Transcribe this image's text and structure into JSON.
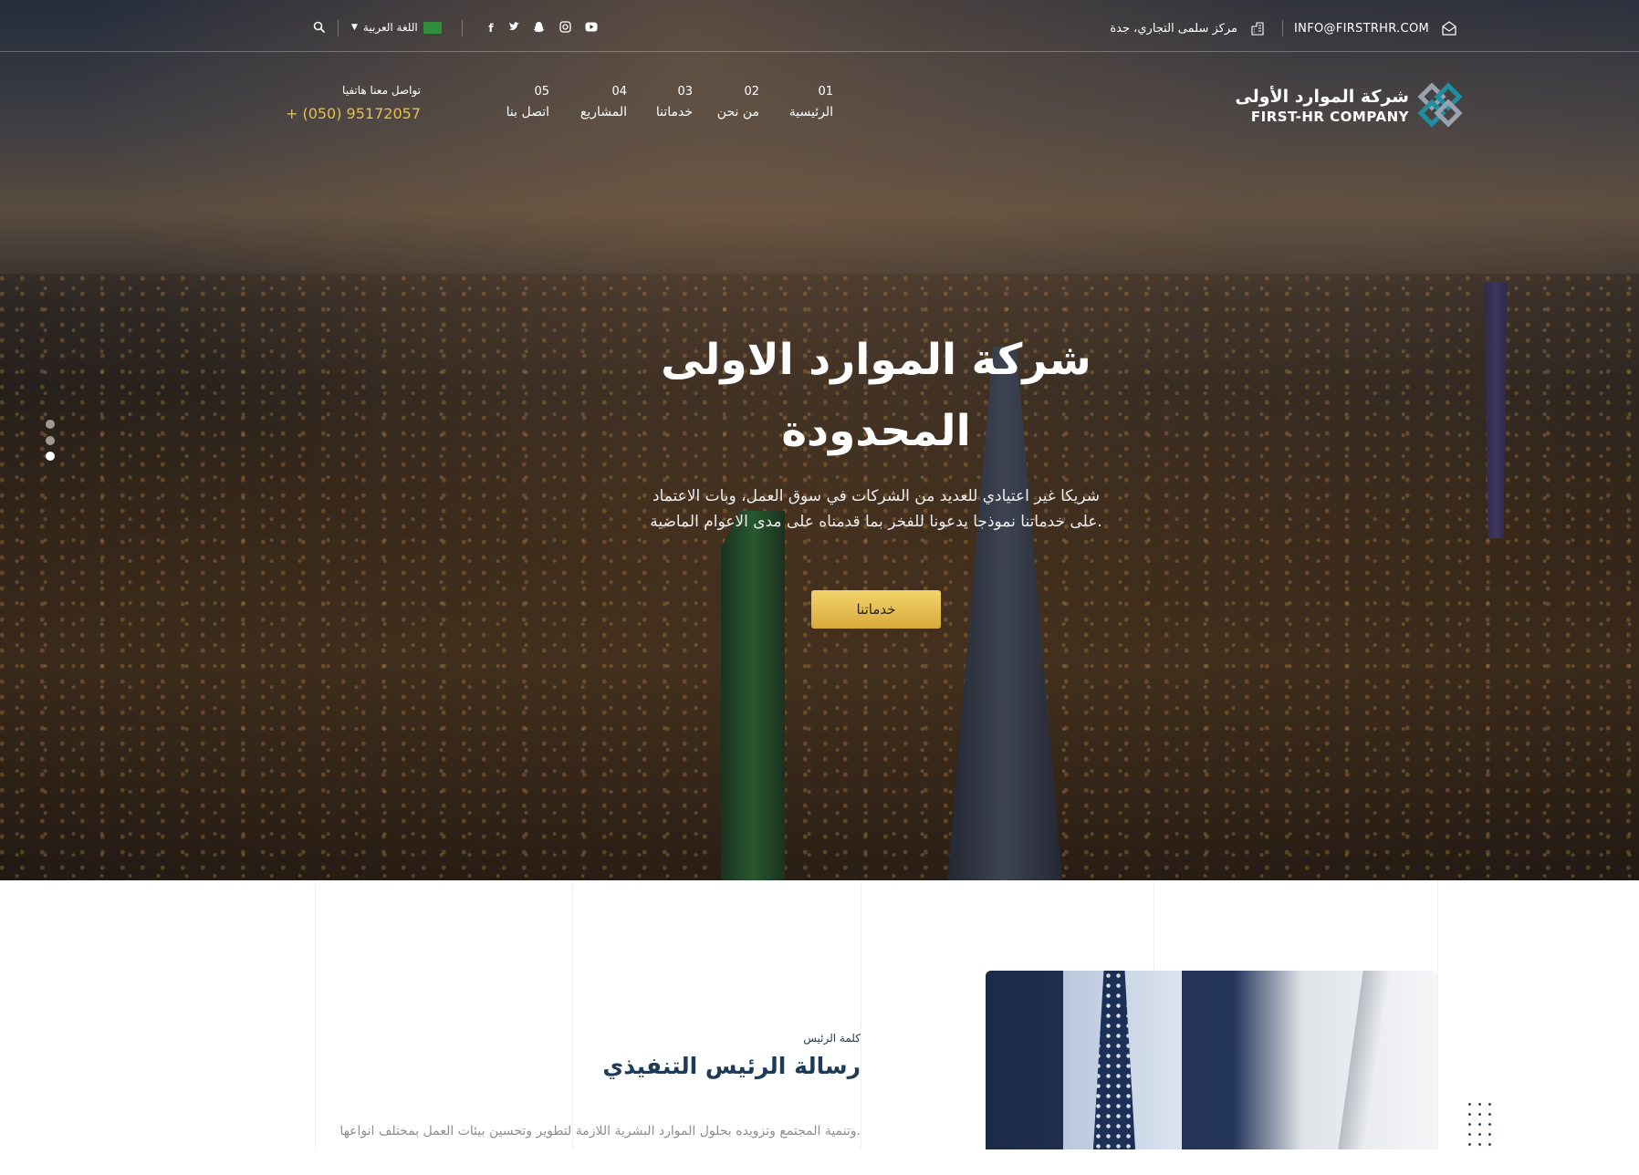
{
  "topbar": {
    "email": "INFO@FIRSTRHR.COM",
    "address": "مركز سلمى التجاري، جدة",
    "language": "اللغة العربية"
  },
  "brand": {
    "name_ar": "شركة الموارد الأولى",
    "name_en": "FIRST-HR COMPANY"
  },
  "nav": [
    {
      "num": "01",
      "label": "الرئيسية"
    },
    {
      "num": "02",
      "label": "من نحن"
    },
    {
      "num": "03",
      "label": "خدماتنا"
    },
    {
      "num": "04",
      "label": "المشاريع"
    },
    {
      "num": "05",
      "label": "اتصل بنا"
    }
  ],
  "contact": {
    "label": "تواصل معنا هاتفيا",
    "phone": "+ (050) 95172057"
  },
  "hero": {
    "title_line1": "شركة الموارد الاولى",
    "title_line2": "المحدودة",
    "desc_line1": "شريكا غير اعتيادي للعديد من الشركات في سوق العمل، وبات الاعتماد",
    "desc_line2": "على خدماتنا نموذجا يدعونا للفخر بما قدمناه على مدى الاعوام الماضية.",
    "cta": "خدماتنا",
    "slide_count": 3,
    "active_slide": 3
  },
  "ceo": {
    "eyebrow": "كلمة الرئيس",
    "title": "رسالة الرئيس التنفيذي",
    "text": "وتنمية المجتمع وتزويده بحلول الموارد البشرية اللازمة لتطوير وتحسين بيئات العمل بمختلف انواعها."
  },
  "colors": {
    "accent": "#e7bf4e",
    "brand_teal": "#1f8fa0",
    "heading_navy": "#1d3b57"
  }
}
